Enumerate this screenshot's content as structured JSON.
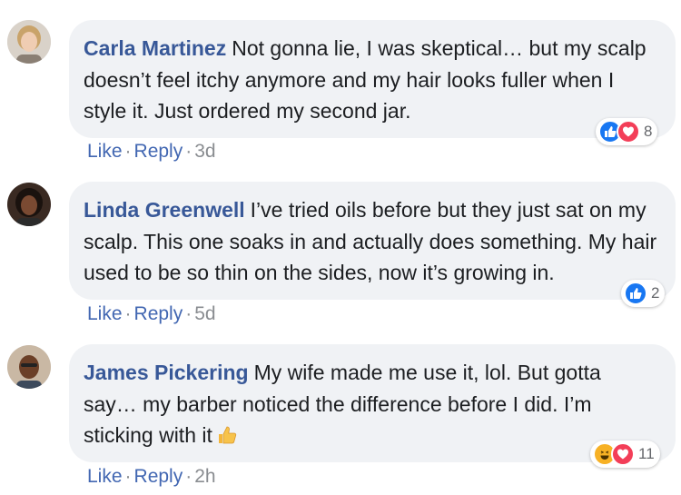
{
  "comments": [
    {
      "author": "Carla Martinez",
      "text": "Not gonna lie, I was skeptical… but my scalp doesn’t feel itchy anymore and my hair looks fuller when I style it. Just ordered my second jar.",
      "actions": {
        "like": "Like",
        "reply": "Reply",
        "time": "3d",
        "sep": "·"
      },
      "reactions": {
        "types": [
          "like",
          "love"
        ],
        "count": "8"
      }
    },
    {
      "author": "Linda Greenwell",
      "text": "I’ve tried oils before but they just sat on my scalp. This one soaks in and actually does something. My hair used to be so thin on the sides, now it’s growing in.",
      "actions": {
        "like": "Like",
        "reply": "Reply",
        "time": "5d",
        "sep": "·"
      },
      "reactions": {
        "types": [
          "like"
        ],
        "count": "2"
      }
    },
    {
      "author": "James Pickering",
      "text": "My wife made me use it, lol. But gotta say… my barber noticed the difference before I did. I’m sticking with it",
      "actions": {
        "like": "Like",
        "reply": "Reply",
        "time": "2h",
        "sep": "·"
      },
      "reactions": {
        "types": [
          "haha",
          "love"
        ],
        "count": "11"
      }
    }
  ],
  "icons": {
    "like": "thumbs-up-icon",
    "love": "heart-icon",
    "haha": "laughing-emoji-icon",
    "inline_emoji": "thumbs-up-emoji"
  },
  "colors": {
    "author": "#385898",
    "link": "#4267b2",
    "bubble": "#f0f2f5",
    "like": "#1877f2",
    "love": "#f33e58",
    "haha": "#f7b125"
  }
}
